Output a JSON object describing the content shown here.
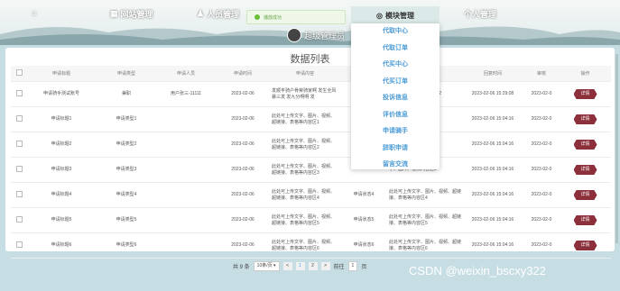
{
  "nav": {
    "website_mgmt": "网站管理",
    "personnel_mgmt": "人员管理",
    "module_mgmt": "模块管理",
    "personal_mgmt": "个人管理"
  },
  "toast": {
    "message": "播放成功"
  },
  "user": {
    "name": "超级管理员"
  },
  "page_title": "数据列表",
  "table": {
    "headers": [
      "申请标题",
      "申请类型",
      "申请人员",
      "申请时间",
      "申请内容",
      "申请状态",
      "审核",
      "回复时间",
      "审核",
      "操作"
    ],
    "rows": [
      [
        "申请骑手测试账号",
        "兼职",
        "用户张三-11111",
        "2023-02-06",
        "发顺丰骑户骨荣骑家啊 发生全风暴三发 发九分啊啊 发",
        "",
        "发送啊啊 代录222 啊啊 22",
        "2023-02-06 15:29:08",
        "2023-02-0",
        "详情"
      ],
      [
        "申请标题1",
        "申请类型1",
        "",
        "2023-02-06",
        "此处可上传文字、图片、视频、超链接、表格等内容区1",
        "",
        "字、图片、视频内容区1",
        "2023-02-06 15:04:16",
        "2023-02-0",
        "详情"
      ],
      [
        "申请标题2",
        "申请类型2",
        "",
        "2023-02-06",
        "此处可上传文字、图片、视频、超链接、表格等内容区2",
        "",
        "字、图片、视频内容区2",
        "2023-02-06 15:04:16",
        "2023-02-0",
        "详情"
      ],
      [
        "申请标题3",
        "申请类型3",
        "",
        "2023-02-06",
        "此处可上传文字、图片、视频、超链接、表格等内容区3",
        "",
        "字、图片、视频内容区3",
        "2023-02-06 15:04:16",
        "2023-02-0",
        "详情"
      ],
      [
        "申请标题4",
        "申请类型4",
        "",
        "2023-02-06",
        "此处可上传文字、图片、视频、超链接、表格等内容区4",
        "申请状态4",
        "此处可上传文字、图片、视频、超链接、表格等内容区4",
        "2023-02-06 15:04:16",
        "2023-02-0",
        "详情"
      ],
      [
        "申请标题5",
        "申请类型5",
        "",
        "2023-02-06",
        "此处可上传文字、图片、视频、超链接、表格等内容区5",
        "申请状态5",
        "此处可上传文字、图片、视频、超链接、表格等内容区5",
        "2023-02-06 15:04:16",
        "2023-02-0",
        "详情"
      ],
      [
        "申请标题6",
        "申请类型6",
        "",
        "2023-02-06",
        "此处可上传文字、图片、视频、超链接、表格等内容区6",
        "申请状态6",
        "此处可上传文字、图片、视频、超链接、表格等内容区6",
        "2023-02-06 15:04:16",
        "2023-02-0",
        "详情"
      ]
    ]
  },
  "dropdown": {
    "items": [
      "代取中心",
      "代取订单",
      "代买中心",
      "代买订单",
      "投诉信息",
      "评价信息",
      "申请骑手",
      "辞职申请",
      "留言交流"
    ]
  },
  "pager": {
    "total": "共 9 条",
    "page_size": "10条/页",
    "prev": "<",
    "pages": [
      "1",
      "2"
    ],
    "next": ">",
    "goto": "前往",
    "current": "1",
    "page_unit": "页"
  },
  "watermark": "CSDN @weixin_bscxy322",
  "colors": {
    "accent": "#4b9bd6",
    "detail_button": "#8b2f3a",
    "background": "#c6dde3"
  }
}
